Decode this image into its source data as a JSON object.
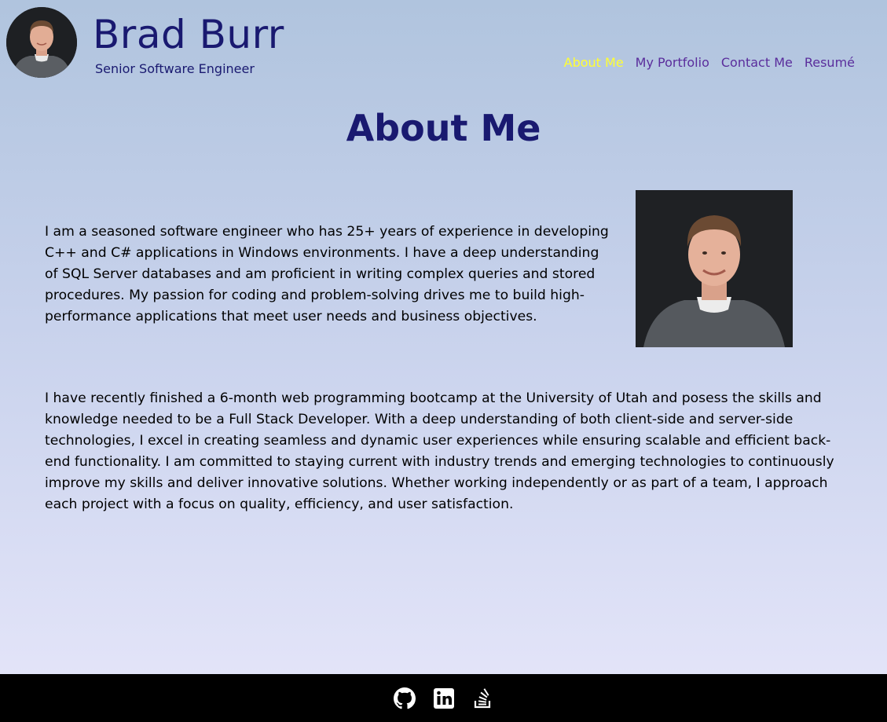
{
  "header": {
    "name": "Brad Burr",
    "title": "Senior Software Engineer",
    "avatar_icon": "person-headshot-icon"
  },
  "nav": {
    "items": [
      {
        "label": "About Me",
        "active": true
      },
      {
        "label": "My Portfolio",
        "active": false
      },
      {
        "label": "Contact Me",
        "active": false
      },
      {
        "label": "Resumé",
        "active": false
      }
    ]
  },
  "main": {
    "heading": "About Me",
    "paragraph1": "I am a seasoned software engineer who has 25+ years of experience in developing C++ and C# applications in Windows environments. I have a deep understanding of SQL Server databases and am proficient in writing complex queries and stored procedures. My passion for coding and problem-solving drives me to build high-performance applications that meet user needs and business objectives.",
    "paragraph2": "I have recently finished a 6-month web programming bootcamp at the University of Utah and posess the skills and knowledge needed to be a Full Stack Developer. With a deep understanding of both client-side and server-side technologies, I excel in creating seamless and dynamic user experiences while ensuring scalable and efficient back-end functionality. I am committed to staying current with industry trends and emerging technologies to continuously improve my skills and deliver innovative solutions. Whether working independently or as part of a team, I approach each project with a focus on quality, efficiency, and user satisfaction."
  },
  "footer": {
    "icons": [
      "github-icon",
      "linkedin-icon",
      "stackoverflow-icon"
    ]
  },
  "colors": {
    "heading": "#191970",
    "nav_link": "#5a2d9c",
    "nav_active": "#ffff33",
    "footer_bg": "#000000",
    "page_gradient_top": "#b0c4de",
    "page_gradient_bottom": "#e6e6fa"
  }
}
